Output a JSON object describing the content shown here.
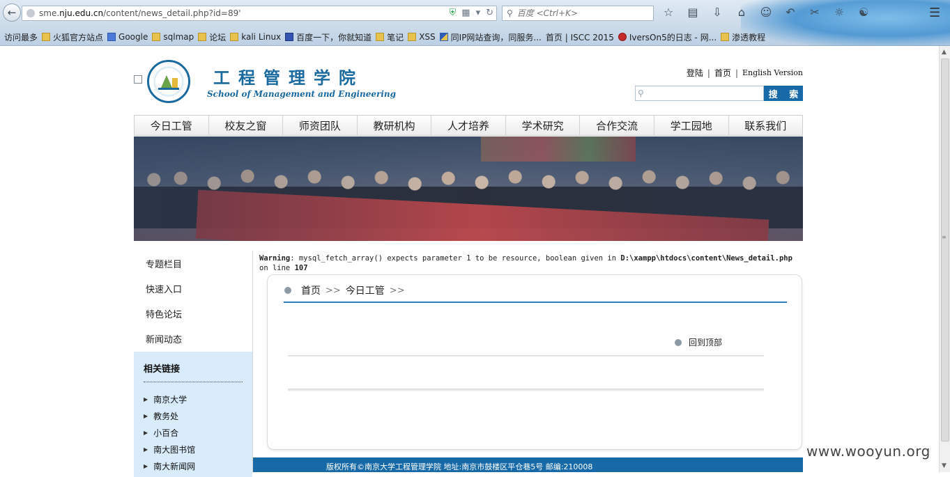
{
  "browser": {
    "url_prefix": "sme.",
    "url_domain": "nju.edu.cn",
    "url_path": "/content/news_detail.php?id=89'",
    "search_placeholder": "百度 <Ctrl+K>",
    "icons": [
      "back-icon",
      "shield-icon",
      "qr-icon",
      "dropdown-icon",
      "reload-icon",
      "star-icon",
      "reading-list-icon",
      "download-icon",
      "home-icon",
      "chat-icon",
      "undo-icon",
      "screenshot-icon",
      "weibo-icon",
      "ghost-icon",
      "menu-icon"
    ]
  },
  "bookmarks": [
    {
      "label": "访问最多",
      "icon": "page"
    },
    {
      "label": "火狐官方站点",
      "icon": "folder"
    },
    {
      "label": "Google",
      "icon": "g"
    },
    {
      "label": "sqlmap",
      "icon": "folder"
    },
    {
      "label": "论坛",
      "icon": "folder"
    },
    {
      "label": "kali Linux",
      "icon": "folder"
    },
    {
      "label": "百度一下，你就知道",
      "icon": "paw"
    },
    {
      "label": "笔记",
      "icon": "folder"
    },
    {
      "label": "XSS",
      "icon": "folder"
    },
    {
      "label": "同IP网站查询，同服务...",
      "icon": "stripe"
    },
    {
      "label": "首页 | ISCC 2015",
      "icon": "page"
    },
    {
      "label": "IversOn5的日志 - 网...",
      "icon": "red"
    },
    {
      "label": "渗透教程",
      "icon": "folder"
    }
  ],
  "site": {
    "name_cn": "工程管理学院",
    "name_en": "School of Management and Engineering",
    "toplinks": {
      "login": "登陆",
      "home": "首页",
      "english": "English Version"
    },
    "search_button": "搜 索",
    "search_value": ""
  },
  "nav": [
    "今日工管",
    "校友之窗",
    "师资团队",
    "教研机构",
    "人才培养",
    "学术研究",
    "合作交流",
    "学工园地",
    "联系我们"
  ],
  "sidebar": {
    "items": [
      "专题栏目",
      "快速入口",
      "特色论坛",
      "新闻动态"
    ],
    "links_title": "相关链接",
    "links": [
      "南京大学",
      "教务处",
      "小百合",
      "南大图书馆",
      "南大新闻网"
    ]
  },
  "warning": {
    "label": "Warning",
    "message": ": mysql_fetch_array() expects parameter 1 to be resource, boolean given in ",
    "file": "D:\\xampp\\htdocs\\content\\News_detail.php",
    "line_prefix": "on line ",
    "line": "107"
  },
  "breadcrumb": {
    "home": "首页",
    "sep": ">>",
    "section": "今日工管"
  },
  "back_to_top": "回到顶部",
  "footer": "版权所有©南京大学工程管理学院  地址:南京市鼓楼区平仓巷5号  邮编:210008",
  "watermark": "www.wooyun.org",
  "colors": {
    "brand_blue": "#1769a8",
    "link_bg": "#d9ecfb"
  }
}
